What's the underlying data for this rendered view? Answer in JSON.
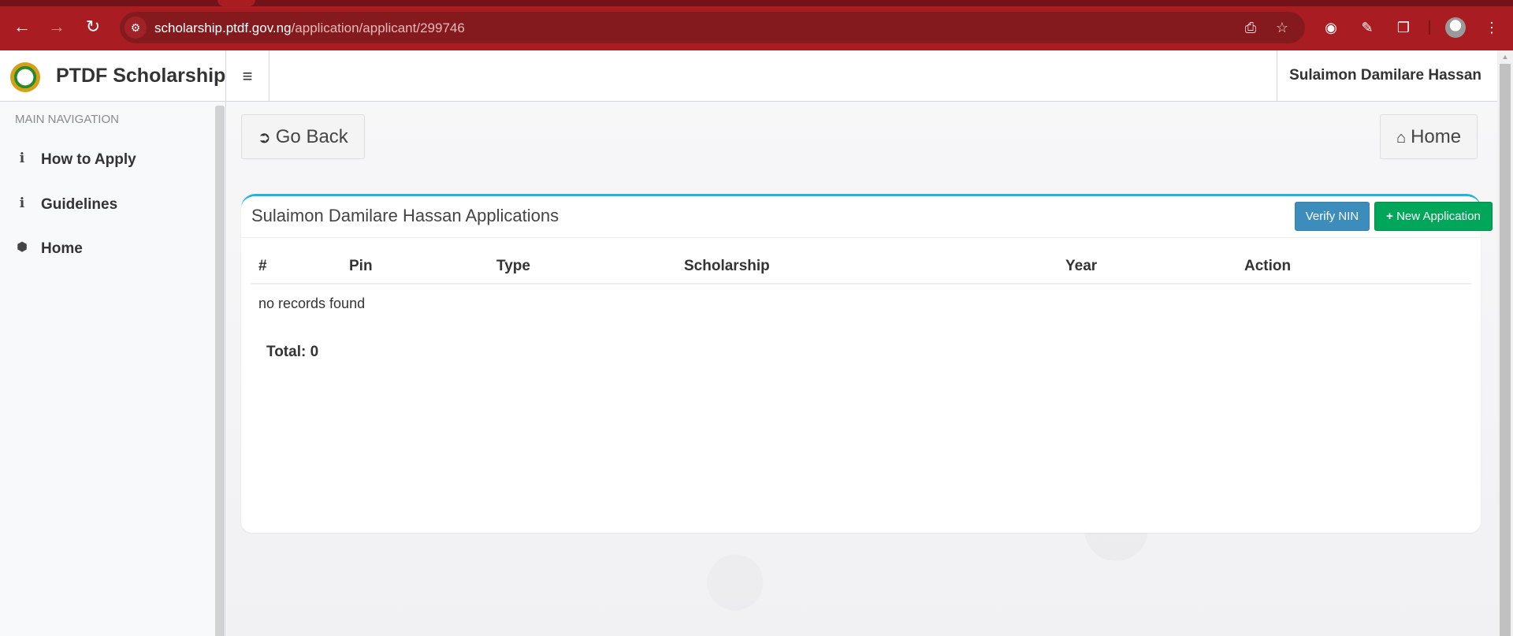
{
  "browser": {
    "url_host": "scholarship.ptdf.gov.ng",
    "url_path": "/application/applicant/299746",
    "back_icon": "arrow-left-icon",
    "forward_icon": "arrow-right-icon",
    "reload_icon": "reload-icon",
    "site_info_icon": "tune-icon",
    "omnibox_icons": [
      "install-app-icon",
      "bookmark-star-icon"
    ],
    "extension_icons": [
      "cookie-extension-icon",
      "eyedropper-extension-icon",
      "extensions-puzzle-icon"
    ],
    "menu_icon": "more-vert-icon"
  },
  "header": {
    "brand": "PTDF Scholarship",
    "toggle_icon": "hamburger-icon",
    "user_name": "Sulaimon Damilare Hassan"
  },
  "sidebar": {
    "section_header": "MAIN NAVIGATION",
    "items": [
      {
        "label": "How to Apply",
        "icon": "info-icon",
        "glyph": "i"
      },
      {
        "label": "Guidelines",
        "icon": "info-icon",
        "glyph": "i"
      },
      {
        "label": "Home",
        "icon": "cube-icon",
        "glyph": "⬢"
      }
    ]
  },
  "content": {
    "go_back_label": "Go Back",
    "home_label": "Home",
    "card": {
      "title": "Sulaimon Damilare Hassan Applications",
      "verify_nin_label": "Verify NIN",
      "new_application_label": "New Application",
      "columns": [
        "#",
        "Pin",
        "Type",
        "Scholarship",
        "Year",
        "Action"
      ],
      "empty_message": "no records found",
      "total_label": "Total: 0"
    }
  }
}
